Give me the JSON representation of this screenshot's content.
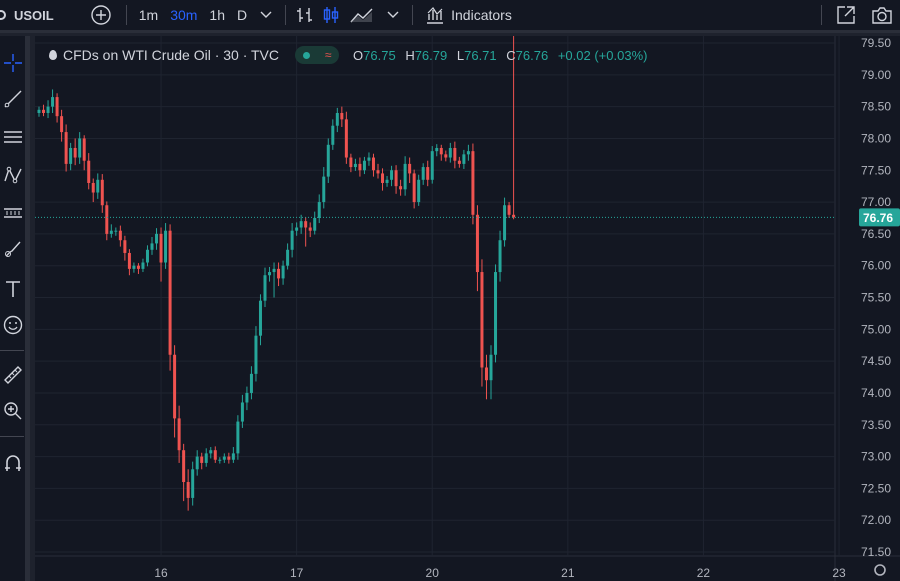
{
  "toolbar": {
    "symbol": "USOIL",
    "timeframes": [
      "1m",
      "30m",
      "1h",
      "D"
    ],
    "active_timeframe": "30m",
    "indicators_label": "Indicators",
    "accent": "#2962ff"
  },
  "legend": {
    "title": "CFDs on WTI Crude Oil · 30 · TVC",
    "o_key": "O",
    "o": "76.75",
    "h_key": "H",
    "h": "76.79",
    "l_key": "L",
    "l": "76.71",
    "c_key": "C",
    "c": "76.76",
    "change": "+0.02 (+0.03%)"
  },
  "chart_data": {
    "type": "line",
    "title": "",
    "xlabel": "",
    "ylabel": "",
    "last_price": "76.76",
    "last_price_value": 76.76,
    "up_color": "#26a69a",
    "down_color": "#ef5350",
    "ylim": [
      71.5,
      79.5
    ],
    "yticks": [
      "79.50",
      "79.00",
      "78.50",
      "78.00",
      "77.50",
      "77.00",
      "76.50",
      "76.00",
      "75.50",
      "75.00",
      "74.50",
      "74.00",
      "73.50",
      "73.00",
      "72.50",
      "72.00",
      "71.50"
    ],
    "yticks_values": [
      79.5,
      79.0,
      78.5,
      78.0,
      77.5,
      77.0,
      76.5,
      76.0,
      75.5,
      75.0,
      74.5,
      74.0,
      73.5,
      73.0,
      72.5,
      72.0,
      71.5
    ],
    "xticks": [
      "16",
      "17",
      "20",
      "21",
      "22",
      "23"
    ],
    "xticks_index": [
      27,
      57,
      87,
      117,
      147,
      177
    ],
    "close": [
      78.45,
      78.4,
      78.5,
      78.65,
      78.35,
      78.1,
      77.6,
      77.85,
      77.7,
      78.0,
      77.65,
      77.3,
      77.15,
      77.35,
      76.95,
      76.5,
      76.55,
      76.55,
      76.4,
      76.2,
      75.95,
      76.0,
      75.95,
      76.05,
      76.25,
      76.35,
      76.5,
      76.05,
      76.55,
      74.6,
      73.6,
      73.1,
      72.6,
      72.35,
      72.8,
      73.0,
      72.9,
      73.05,
      73.1,
      72.95,
      72.95,
      73.0,
      72.95,
      73.05,
      73.55,
      73.85,
      74.0,
      74.3,
      74.9,
      75.45,
      75.85,
      75.9,
      75.95,
      75.8,
      76.0,
      76.25,
      76.55,
      76.6,
      76.7,
      76.6,
      76.55,
      76.75,
      77.0,
      77.4,
      77.9,
      78.2,
      78.4,
      78.3,
      77.7,
      77.55,
      77.6,
      77.5,
      77.65,
      77.7,
      77.5,
      77.45,
      77.3,
      77.35,
      77.5,
      77.25,
      77.2,
      77.6,
      77.45,
      77.0,
      77.35,
      77.55,
      77.35,
      77.8,
      77.85,
      77.75,
      77.7,
      77.85,
      77.65,
      77.6,
      77.75,
      77.8,
      76.8,
      75.9,
      74.4,
      74.2,
      74.6,
      75.9,
      76.4,
      76.95,
      76.8,
      76.76
    ],
    "open_first": 78.4,
    "high_extra": [
      0.05,
      0.08,
      0.1,
      0.12,
      0.06,
      0.1,
      0.12,
      0.08,
      0.15,
      0.1,
      0.05,
      0.12,
      0.07,
      0.1,
      0.09,
      0.06,
      0.1,
      0.05,
      0.08,
      0.07,
      0.06,
      0.05,
      0.04,
      0.06,
      0.07,
      0.1,
      0.09,
      0.1,
      0.12,
      0.1,
      0.15,
      0.2,
      0.1,
      0.2,
      0.12,
      0.1,
      0.06,
      0.08,
      0.05,
      0.06,
      0.04,
      0.05,
      0.06,
      0.1,
      0.1,
      0.12,
      0.1,
      0.12,
      0.15,
      0.1,
      0.12,
      0.08,
      0.1,
      0.1,
      0.08,
      0.1,
      0.12,
      0.08,
      0.1,
      0.06,
      0.08,
      0.1,
      0.12,
      0.15,
      0.1,
      0.1,
      0.08,
      0.1,
      0.12,
      0.06,
      0.08,
      0.1,
      0.06,
      0.08,
      0.06,
      0.1,
      0.08,
      0.06,
      0.07,
      0.08,
      0.1,
      0.12,
      0.1,
      0.06,
      0.08,
      0.06,
      0.1,
      0.08,
      0.06,
      0.05,
      0.06,
      0.08,
      0.1,
      0.06,
      0.07,
      0.1,
      0.12,
      0.15,
      0.2,
      0.2,
      0.15,
      0.12,
      0.15,
      0.12,
      0.05
    ],
    "low_extra": [
      0.06,
      0.05,
      0.08,
      0.1,
      0.1,
      0.15,
      0.12,
      0.1,
      0.12,
      0.1,
      0.15,
      0.1,
      0.15,
      0.1,
      0.12,
      0.1,
      0.06,
      0.08,
      0.1,
      0.12,
      0.1,
      0.06,
      0.08,
      0.05,
      0.06,
      0.08,
      0.1,
      0.3,
      0.1,
      0.25,
      0.3,
      0.2,
      0.3,
      0.2,
      0.12,
      0.1,
      0.1,
      0.06,
      0.08,
      0.05,
      0.06,
      0.05,
      0.06,
      0.05,
      0.1,
      0.1,
      0.12,
      0.1,
      0.12,
      0.15,
      0.1,
      0.1,
      0.4,
      0.12,
      0.1,
      0.06,
      0.12,
      0.08,
      0.1,
      0.3,
      0.1,
      0.06,
      0.08,
      0.1,
      0.1,
      0.08,
      0.1,
      0.12,
      0.1,
      0.08,
      0.06,
      0.1,
      0.06,
      0.08,
      0.1,
      0.08,
      0.12,
      0.06,
      0.1,
      0.12,
      0.1,
      0.1,
      0.15,
      0.1,
      0.06,
      0.08,
      0.1,
      0.06,
      0.08,
      0.1,
      0.06,
      0.08,
      0.12,
      0.06,
      0.08,
      0.1,
      0.15,
      0.3,
      0.3,
      0.3,
      0.3,
      0.12,
      0.15,
      0.1,
      0.05,
      0.03
    ]
  }
}
